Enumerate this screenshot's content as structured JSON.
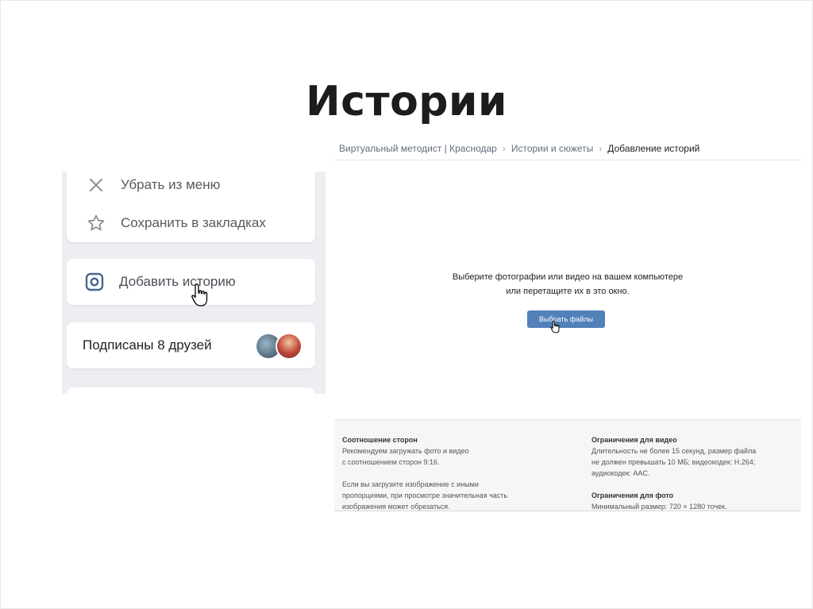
{
  "slide": {
    "title": "Истории"
  },
  "left_panel": {
    "menu": [
      {
        "label": "Убрать из меню",
        "icon": "close-icon"
      },
      {
        "label": "Сохранить в закладках",
        "icon": "star-icon"
      }
    ],
    "add_story_label": "Добавить историю",
    "friends_label": "Подписаны 8 друзей"
  },
  "right_panel": {
    "breadcrumbs": [
      "Виртуальный методист | Краснодар",
      "Истории и сюжеты",
      "Добавление историй"
    ],
    "upload_line1": "Выберите фотографии или видео на вашем компьютере",
    "upload_line2": "или перетащите их в это окно.",
    "choose_button": "Выбрать файлы",
    "info": {
      "aspect_title": "Соотношение сторон",
      "aspect_line1": "Рекомендуем загружать фото и видео",
      "aspect_line2": "с соотношением сторон 9:16.",
      "aspect_line3": "Если вы загрузите изображение с иными",
      "aspect_line4": "пропорциями, при просмотре значительная часть",
      "aspect_line5": "изображения может обрезаться.",
      "video_title": "Ограничения для видео",
      "video_line1": "Длительность не более 15 секунд, размер файла",
      "video_line2": "не должен превышать 10 МБ; видеокодек: H.264;",
      "video_line3": "аудиокодек: AAC.",
      "photo_title": "Ограничения для фото",
      "photo_line1": "Минимальный размер: 720 × 1280 точек."
    }
  },
  "colors": {
    "accent": "#5181b8",
    "panel_bg": "#eceef2"
  }
}
